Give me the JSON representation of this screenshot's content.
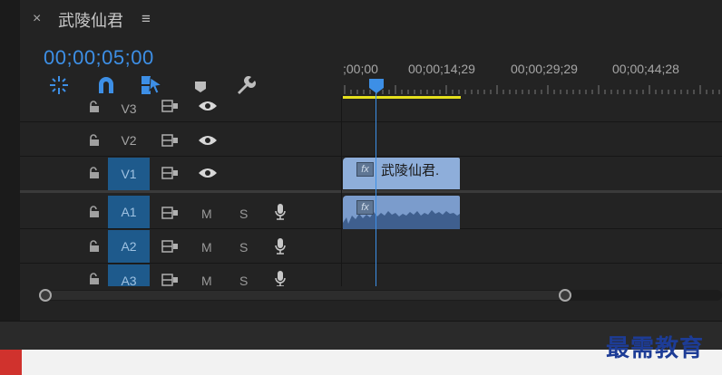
{
  "sequence": {
    "title": "武陵仙君",
    "close_glyph": "×",
    "menu_glyph": "≡"
  },
  "timecode": "00;00;05;00",
  "toolbar": {
    "tools": [
      {
        "name": "nest-sequence-icon"
      },
      {
        "name": "snap-magnet-icon"
      },
      {
        "name": "linked-selection-icon"
      },
      {
        "name": "add-marker-icon"
      },
      {
        "name": "timeline-settings-wrench-icon"
      }
    ]
  },
  "ruler": {
    "labels": [
      ";00;00",
      "00;00;14;29",
      "00;00;29;29",
      "00;00;44;28"
    ]
  },
  "tracks": {
    "video": [
      {
        "name": "V3",
        "targeted": false
      },
      {
        "name": "V2",
        "targeted": false
      },
      {
        "name": "V1",
        "targeted": true
      }
    ],
    "audio": [
      {
        "name": "A1",
        "mute": "M",
        "solo": "S"
      },
      {
        "name": "A2",
        "mute": "M",
        "solo": "S"
      },
      {
        "name": "A3",
        "mute": "M",
        "solo": "S"
      }
    ]
  },
  "clips": {
    "video": {
      "fx": "fx",
      "label": "武陵仙君."
    },
    "audio": {
      "fx": "fx"
    }
  },
  "watermark": "最需教育",
  "colors": {
    "accent": "#3d8fe6",
    "work_area": "#e6e01d",
    "video_clip": "#8eaeda",
    "audio_clip": "#7b9ccc",
    "track_target": "#1e5a8c"
  }
}
